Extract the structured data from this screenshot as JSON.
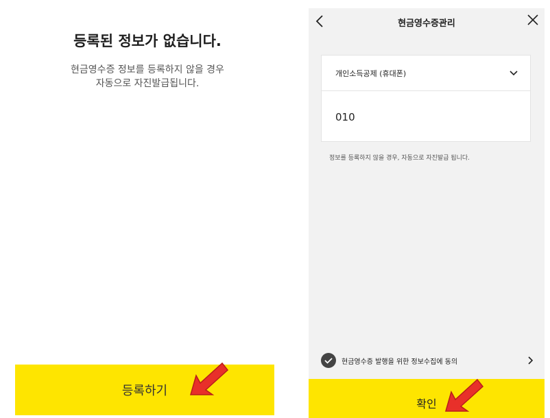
{
  "left_screen": {
    "empty_title": "등록된 정보가 없습니다.",
    "empty_desc_line1": "현금영수증 정보를 등록하지 않을 경우",
    "empty_desc_line2": "자동으로 자진발급됩니다.",
    "register_button": "등록하기"
  },
  "right_screen": {
    "title": "현금영수증관리",
    "back_icon": "chevron-left-icon",
    "close_icon": "close-icon",
    "select_value": "개인소득공제 (휴대폰)",
    "phone_value": "010",
    "notice": "정보를 등록하지 않을 경우, 자동으로 자진발급 됩니다.",
    "agree_label": "현금영수증 발행을 위한 정보수집에 동의",
    "confirm_button": "확인"
  },
  "colors": {
    "accent_yellow": "#fee500",
    "arrow_red": "#e8302a",
    "panel_bg": "#f2f2f2"
  }
}
